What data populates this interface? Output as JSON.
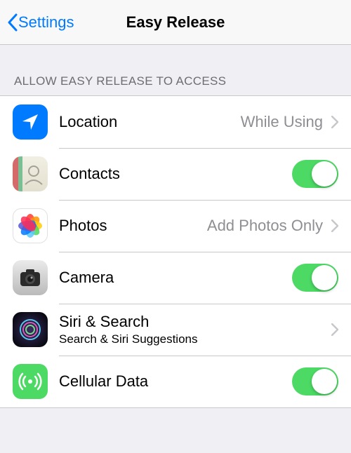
{
  "header": {
    "back_label": "Settings",
    "title": "Easy Release"
  },
  "section_header": "ALLOW EASY RELEASE TO ACCESS",
  "rows": {
    "location": {
      "label": "Location",
      "value": "While Using"
    },
    "contacts": {
      "label": "Contacts",
      "toggle": true
    },
    "photos": {
      "label": "Photos",
      "value": "Add Photos Only"
    },
    "camera": {
      "label": "Camera",
      "toggle": true
    },
    "siri": {
      "label": "Siri & Search",
      "sublabel": "Search & Siri Suggestions"
    },
    "cellular": {
      "label": "Cellular Data",
      "toggle": true
    }
  }
}
